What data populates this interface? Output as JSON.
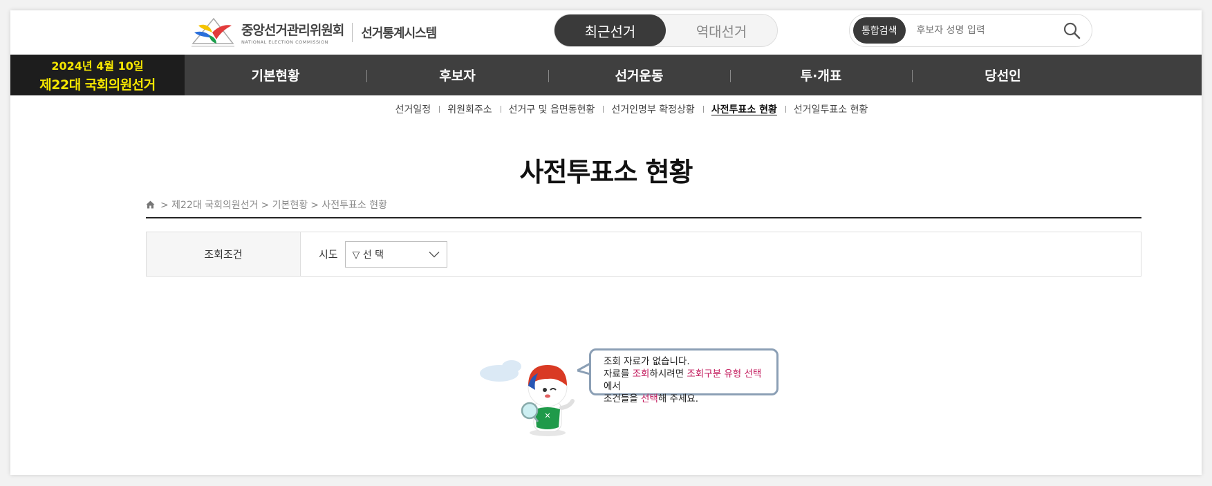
{
  "header": {
    "org_name_kr": "중앙선거관리위원회",
    "org_name_en": "NATIONAL ELECTION COMMISSION",
    "system_name": "선거통계시스템",
    "toggle": [
      {
        "label": "최근선거",
        "active": true
      },
      {
        "label": "역대선거",
        "active": false
      }
    ],
    "search": {
      "tag": "통합검색",
      "placeholder": "후보자 성명 입력",
      "icon": "search-icon"
    }
  },
  "nav": {
    "election_date": "2024년 4월 10일",
    "election_name": "제22대 국회의원선거",
    "items": [
      "기본현황",
      "후보자",
      "선거운동",
      "투·개표",
      "당선인"
    ]
  },
  "subnav": {
    "items": [
      "선거일정",
      "위원회주소",
      "선거구 및 읍면동현황",
      "선거인명부 확정상황",
      "사전투표소 현황",
      "선거일투표소 현황"
    ],
    "active_index": 4
  },
  "page": {
    "title": "사전투표소 현황",
    "breadcrumb": [
      "> 제22대 국회의원선거",
      "> 기본현황",
      "> 사전투표소 현황"
    ]
  },
  "query": {
    "label": "조회조건",
    "field_label": "시도",
    "select_value": "▽ 선 택"
  },
  "empty": {
    "line1": "조회 자료가 없습니다.",
    "line2_a": "자료를 ",
    "line2_b": "조회",
    "line2_c": "하시려면 ",
    "line2_d": "조회구분 유형 선택",
    "line2_e": "에서",
    "line3_a": "조건들을 ",
    "line3_b": "선택",
    "line3_c": "해 주세요."
  },
  "colors": {
    "nav_bg": "#3f3f3f",
    "election_label_bg": "#1d1d1d",
    "election_label_text": "#f5e600",
    "highlight": "#c2185b",
    "bubble_border": "#8b9fb5"
  }
}
